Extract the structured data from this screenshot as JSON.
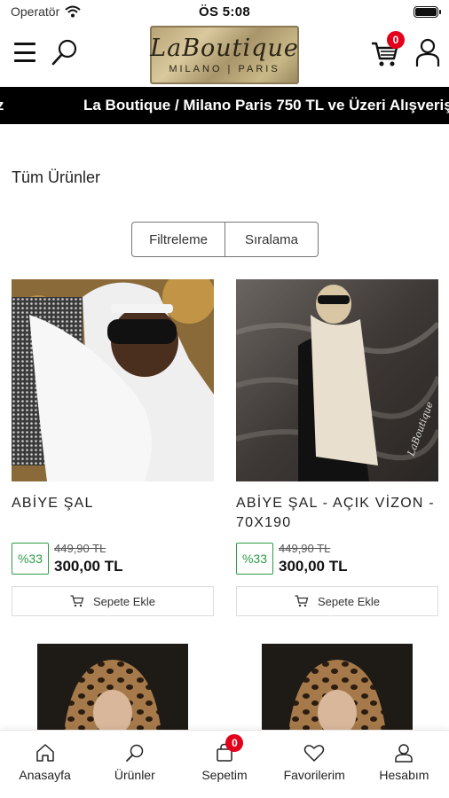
{
  "status_bar": {
    "carrier": "Operatör",
    "time": "ÖS 5:08"
  },
  "header": {
    "logo_script": "LaBoutique",
    "logo_sub": "MILANO | PARIS",
    "cart_count": "0",
    "icons": [
      "menu-icon",
      "search-icon",
      "cart-icon",
      "user-icon"
    ]
  },
  "marquee": {
    "fragment": "retsiz",
    "text": "La Boutique / Milano Paris 750 TL ve Üzeri Alışveriş"
  },
  "page": {
    "title": "Tüm Ürünler",
    "filter_label": "Filtreleme",
    "sort_label": "Sıralama"
  },
  "products": [
    {
      "name": "ABİYE ŞAL",
      "discount": "%33",
      "old_price": "449,90 TL",
      "price": "300,00 TL",
      "add_label": "Sepete Ekle"
    },
    {
      "name": "ABİYE ŞAL - AÇIK VİZON - 70X190",
      "discount": "%33",
      "old_price": "449,90 TL",
      "price": "300,00 TL",
      "add_label": "Sepete Ekle"
    }
  ],
  "tabbar": {
    "items": [
      {
        "label": "Anasayfa",
        "icon": "home-icon"
      },
      {
        "label": "Ürünler",
        "icon": "search-icon"
      },
      {
        "label": "Sepetim",
        "icon": "bag-icon",
        "badge": "0"
      },
      {
        "label": "Favorilerim",
        "icon": "heart-icon"
      },
      {
        "label": "Hesabım",
        "icon": "user-icon"
      }
    ]
  },
  "colors": {
    "accent_red": "#e3001b",
    "discount_green": "#2e9b47",
    "banner_bg": "#000000"
  }
}
